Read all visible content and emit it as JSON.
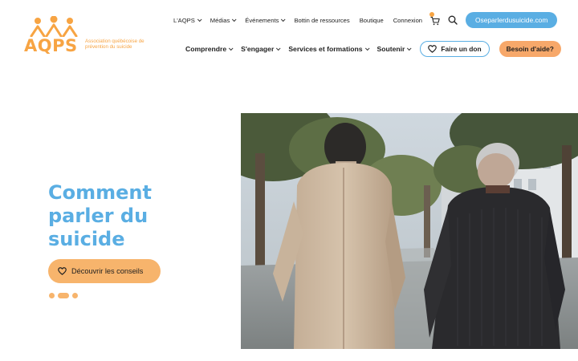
{
  "brand": {
    "wordmark": "AQPS",
    "tagline": "Association québécoise de prévention du suicide",
    "color_primary": "#f7a443",
    "color_accent": "#5aaee3"
  },
  "top_nav": {
    "items": [
      {
        "label": "L'AQPS",
        "has_dropdown": true
      },
      {
        "label": "Médias",
        "has_dropdown": true
      },
      {
        "label": "Événements",
        "has_dropdown": true
      },
      {
        "label": "Bottin de ressources",
        "has_dropdown": false
      },
      {
        "label": "Boutique",
        "has_dropdown": false
      },
      {
        "label": "Connexion",
        "has_dropdown": false
      }
    ],
    "cart_icon": "shopping-cart-icon",
    "search_icon": "search-icon",
    "site_link": "Oseparlerdusuicide.com"
  },
  "main_nav": {
    "items": [
      {
        "label": "Comprendre",
        "has_dropdown": true
      },
      {
        "label": "S'engager",
        "has_dropdown": true
      },
      {
        "label": "Services et formations",
        "has_dropdown": true
      },
      {
        "label": "Soutenir",
        "has_dropdown": true
      }
    ],
    "donate_label": "Faire un don",
    "help_label": "Besoin d'aide?"
  },
  "hero": {
    "title": "Comment parler du suicide",
    "cta_label": "Découvrir les conseils",
    "slider": {
      "count": 3,
      "active_index": 1
    },
    "image_alt_subject": "two older men walking side by side on a tree-lined path"
  }
}
